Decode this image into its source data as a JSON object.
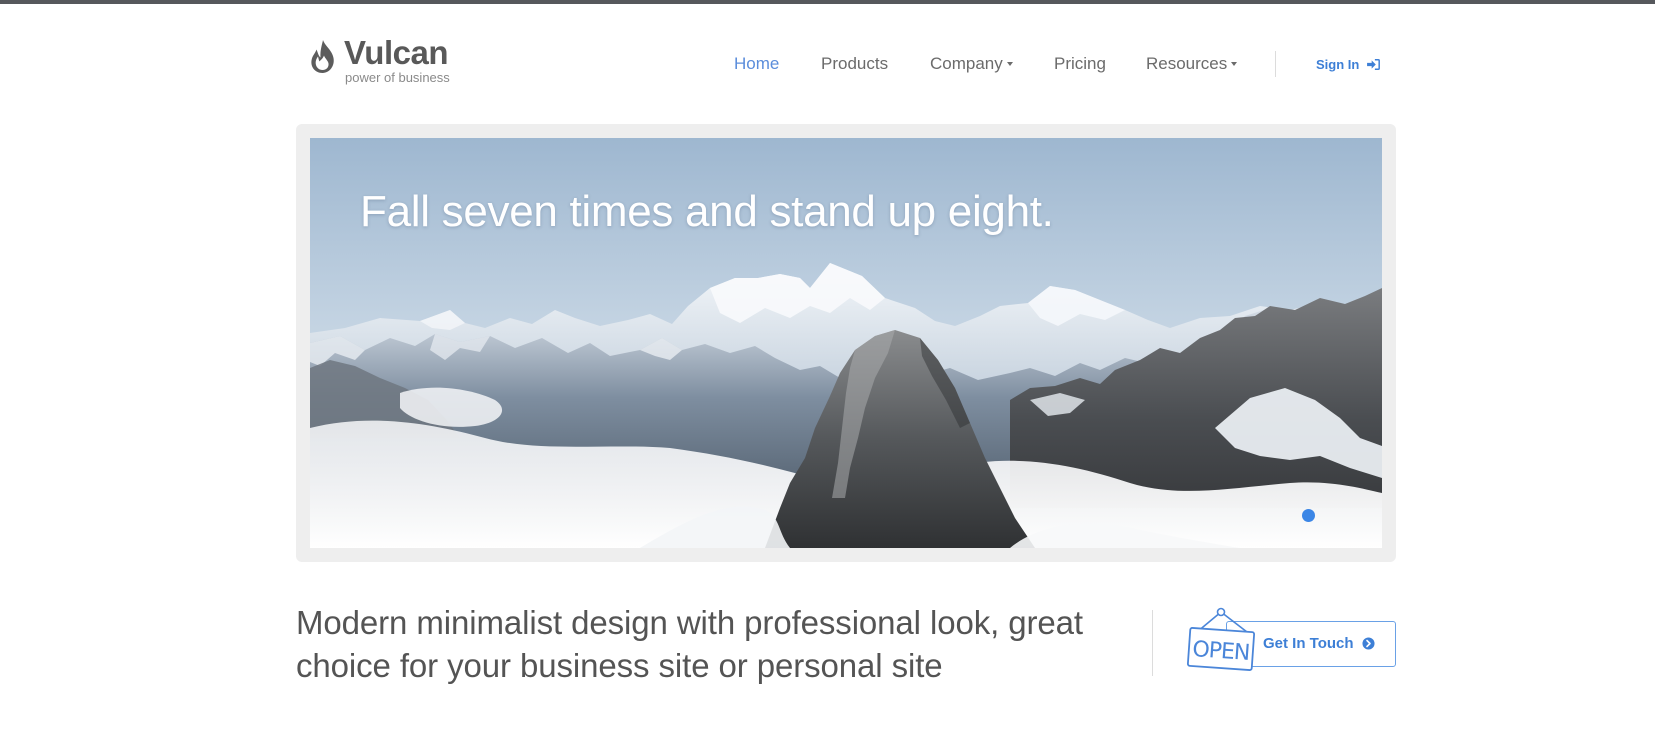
{
  "brand": {
    "name": "Vulcan",
    "tagline": "power of business",
    "logo_icon": "flame-icon"
  },
  "nav": {
    "items": [
      {
        "label": "Home",
        "active": true,
        "has_dropdown": false
      },
      {
        "label": "Products",
        "active": false,
        "has_dropdown": false
      },
      {
        "label": "Company",
        "active": false,
        "has_dropdown": true
      },
      {
        "label": "Pricing",
        "active": false,
        "has_dropdown": false
      },
      {
        "label": "Resources",
        "active": false,
        "has_dropdown": true
      }
    ],
    "sign_in": {
      "label": "Sign In",
      "icon": "sign-in-icon"
    }
  },
  "hero": {
    "caption": "Fall seven times and stand up eight.",
    "slide_count": 1,
    "active_slide": 1
  },
  "intro": {
    "text": "Modern minimalist design with professional look, great choice for your business site or personal site"
  },
  "cta": {
    "label": "Get In Touch",
    "sign_text": "OPEN",
    "icon": "chevron-circle-right-icon"
  },
  "colors": {
    "accent": "#3d7fd6",
    "nav_active": "#5b8ddb",
    "top_rule": "#56585c",
    "frame": "#eeeeee",
    "text": "#545454"
  }
}
